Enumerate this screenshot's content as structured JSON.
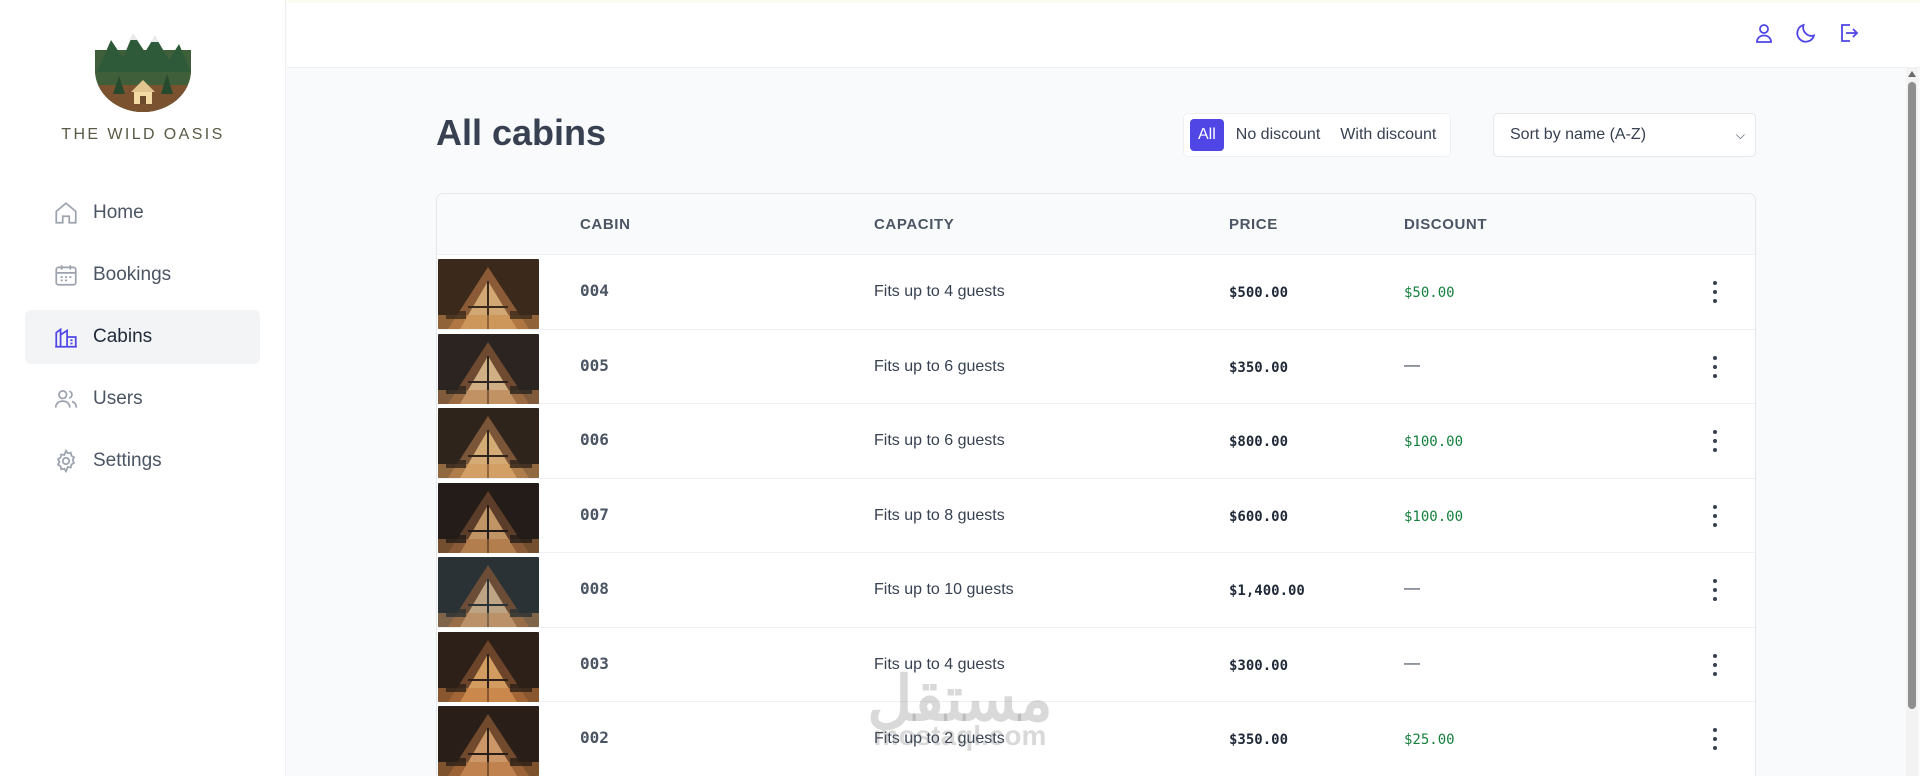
{
  "app": {
    "name": "THE WILD OASIS"
  },
  "sidebar": {
    "items": [
      {
        "label": "Home",
        "icon": "home-icon",
        "active": false
      },
      {
        "label": "Bookings",
        "icon": "calendar-icon",
        "active": false
      },
      {
        "label": "Cabins",
        "icon": "cabin-icon",
        "active": true
      },
      {
        "label": "Users",
        "icon": "users-icon",
        "active": false
      },
      {
        "label": "Settings",
        "icon": "gear-icon",
        "active": false
      }
    ]
  },
  "header": {
    "icons": [
      "user-icon",
      "moon-icon",
      "logout-icon"
    ]
  },
  "main": {
    "title": "All cabins",
    "filter": {
      "options": [
        "All",
        "No discount",
        "With discount"
      ],
      "selected": "All"
    },
    "sort": {
      "selected": "Sort by name (A-Z)"
    },
    "table": {
      "columns": [
        "",
        "CABIN",
        "CAPACITY",
        "PRICE",
        "DISCOUNT",
        ""
      ],
      "rows": [
        {
          "name": "004",
          "capacity": "Fits up to 4 guests",
          "price": "$500.00",
          "discount": "$50.00"
        },
        {
          "name": "005",
          "capacity": "Fits up to 6 guests",
          "price": "$350.00",
          "discount": "—"
        },
        {
          "name": "006",
          "capacity": "Fits up to 6 guests",
          "price": "$800.00",
          "discount": "$100.00"
        },
        {
          "name": "007",
          "capacity": "Fits up to 8 guests",
          "price": "$600.00",
          "discount": "$100.00"
        },
        {
          "name": "008",
          "capacity": "Fits up to 10 guests",
          "price": "$1,400.00",
          "discount": "—"
        },
        {
          "name": "003",
          "capacity": "Fits up to 4 guests",
          "price": "$300.00",
          "discount": "—"
        },
        {
          "name": "002",
          "capacity": "Fits up to 2 guests",
          "price": "$350.00",
          "discount": "$25.00"
        }
      ]
    }
  },
  "watermark": {
    "arabic": "مستقل",
    "latin": "mostaql.com"
  },
  "colors": {
    "accent": "#4f46e5",
    "discount": "#15803d",
    "text": "#374151"
  }
}
